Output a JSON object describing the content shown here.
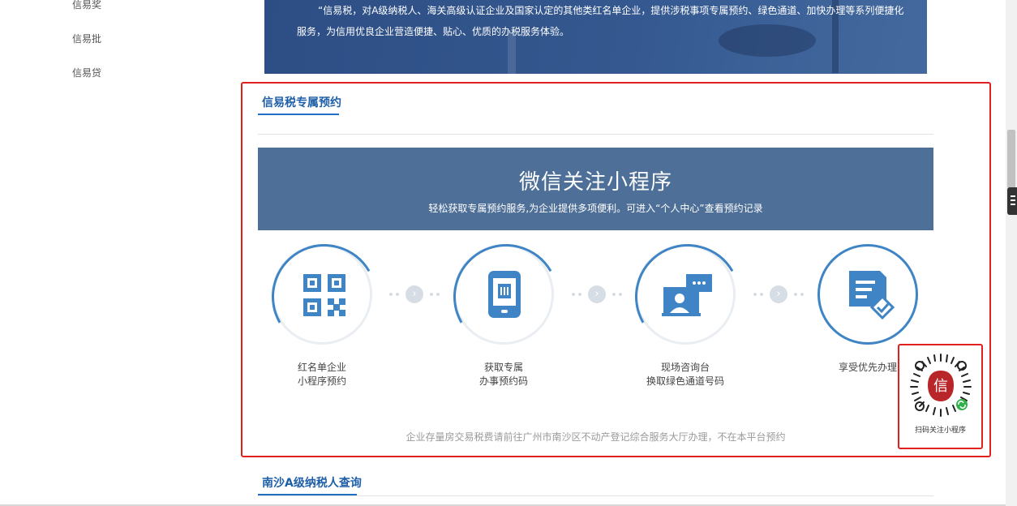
{
  "sidebar": {
    "items": [
      {
        "label": "信易奖"
      },
      {
        "label": "信易批"
      },
      {
        "label": "信易贷"
      }
    ]
  },
  "banner": {
    "text": "“信易税，对A级纳税人、海关高级认证企业及国家认定的其他类红名单企业，提供涉税事项专属预约、绿色通道、加快办理等系列便捷化服务，为信用优良企业营造便捷、贴心、优质的办税服务体验。"
  },
  "booking_section": {
    "title": "信易税专属预约",
    "panel_heading": "微信关注小程序",
    "panel_subheading": "轻松获取专属预约服务,为企业提供多项便利。可进入“个人中心”查看预约记录",
    "steps": [
      {
        "line1": "红名单企业",
        "line2": "小程序预约",
        "icon": "qr-code-icon"
      },
      {
        "line1": "获取专属",
        "line2": "办事预约码",
        "icon": "mobile-phone-icon"
      },
      {
        "line1": "现场咨询台",
        "line2": "换取绿色通道号码",
        "icon": "consultation-chat-icon"
      },
      {
        "line1": "享受优先办理",
        "line2": "",
        "icon": "document-check-icon"
      }
    ],
    "connector_icon": "arrow-right-icon",
    "note": "企业存量房交易税费请前往广州市南沙区不动产登记综合服务大厅办理，不在本平台预约"
  },
  "qr_popup": {
    "caption": "扫码关注小程序",
    "center_char": "信",
    "icon": "mini-program-qr-icon"
  },
  "next_section": {
    "title": "南沙A级纳税人查询"
  },
  "colors": {
    "accent_blue": "#1f5ea8",
    "panel_blue": "#4e6f98",
    "highlight_red": "#e0201c",
    "icon_blue": "#3f84c4"
  }
}
